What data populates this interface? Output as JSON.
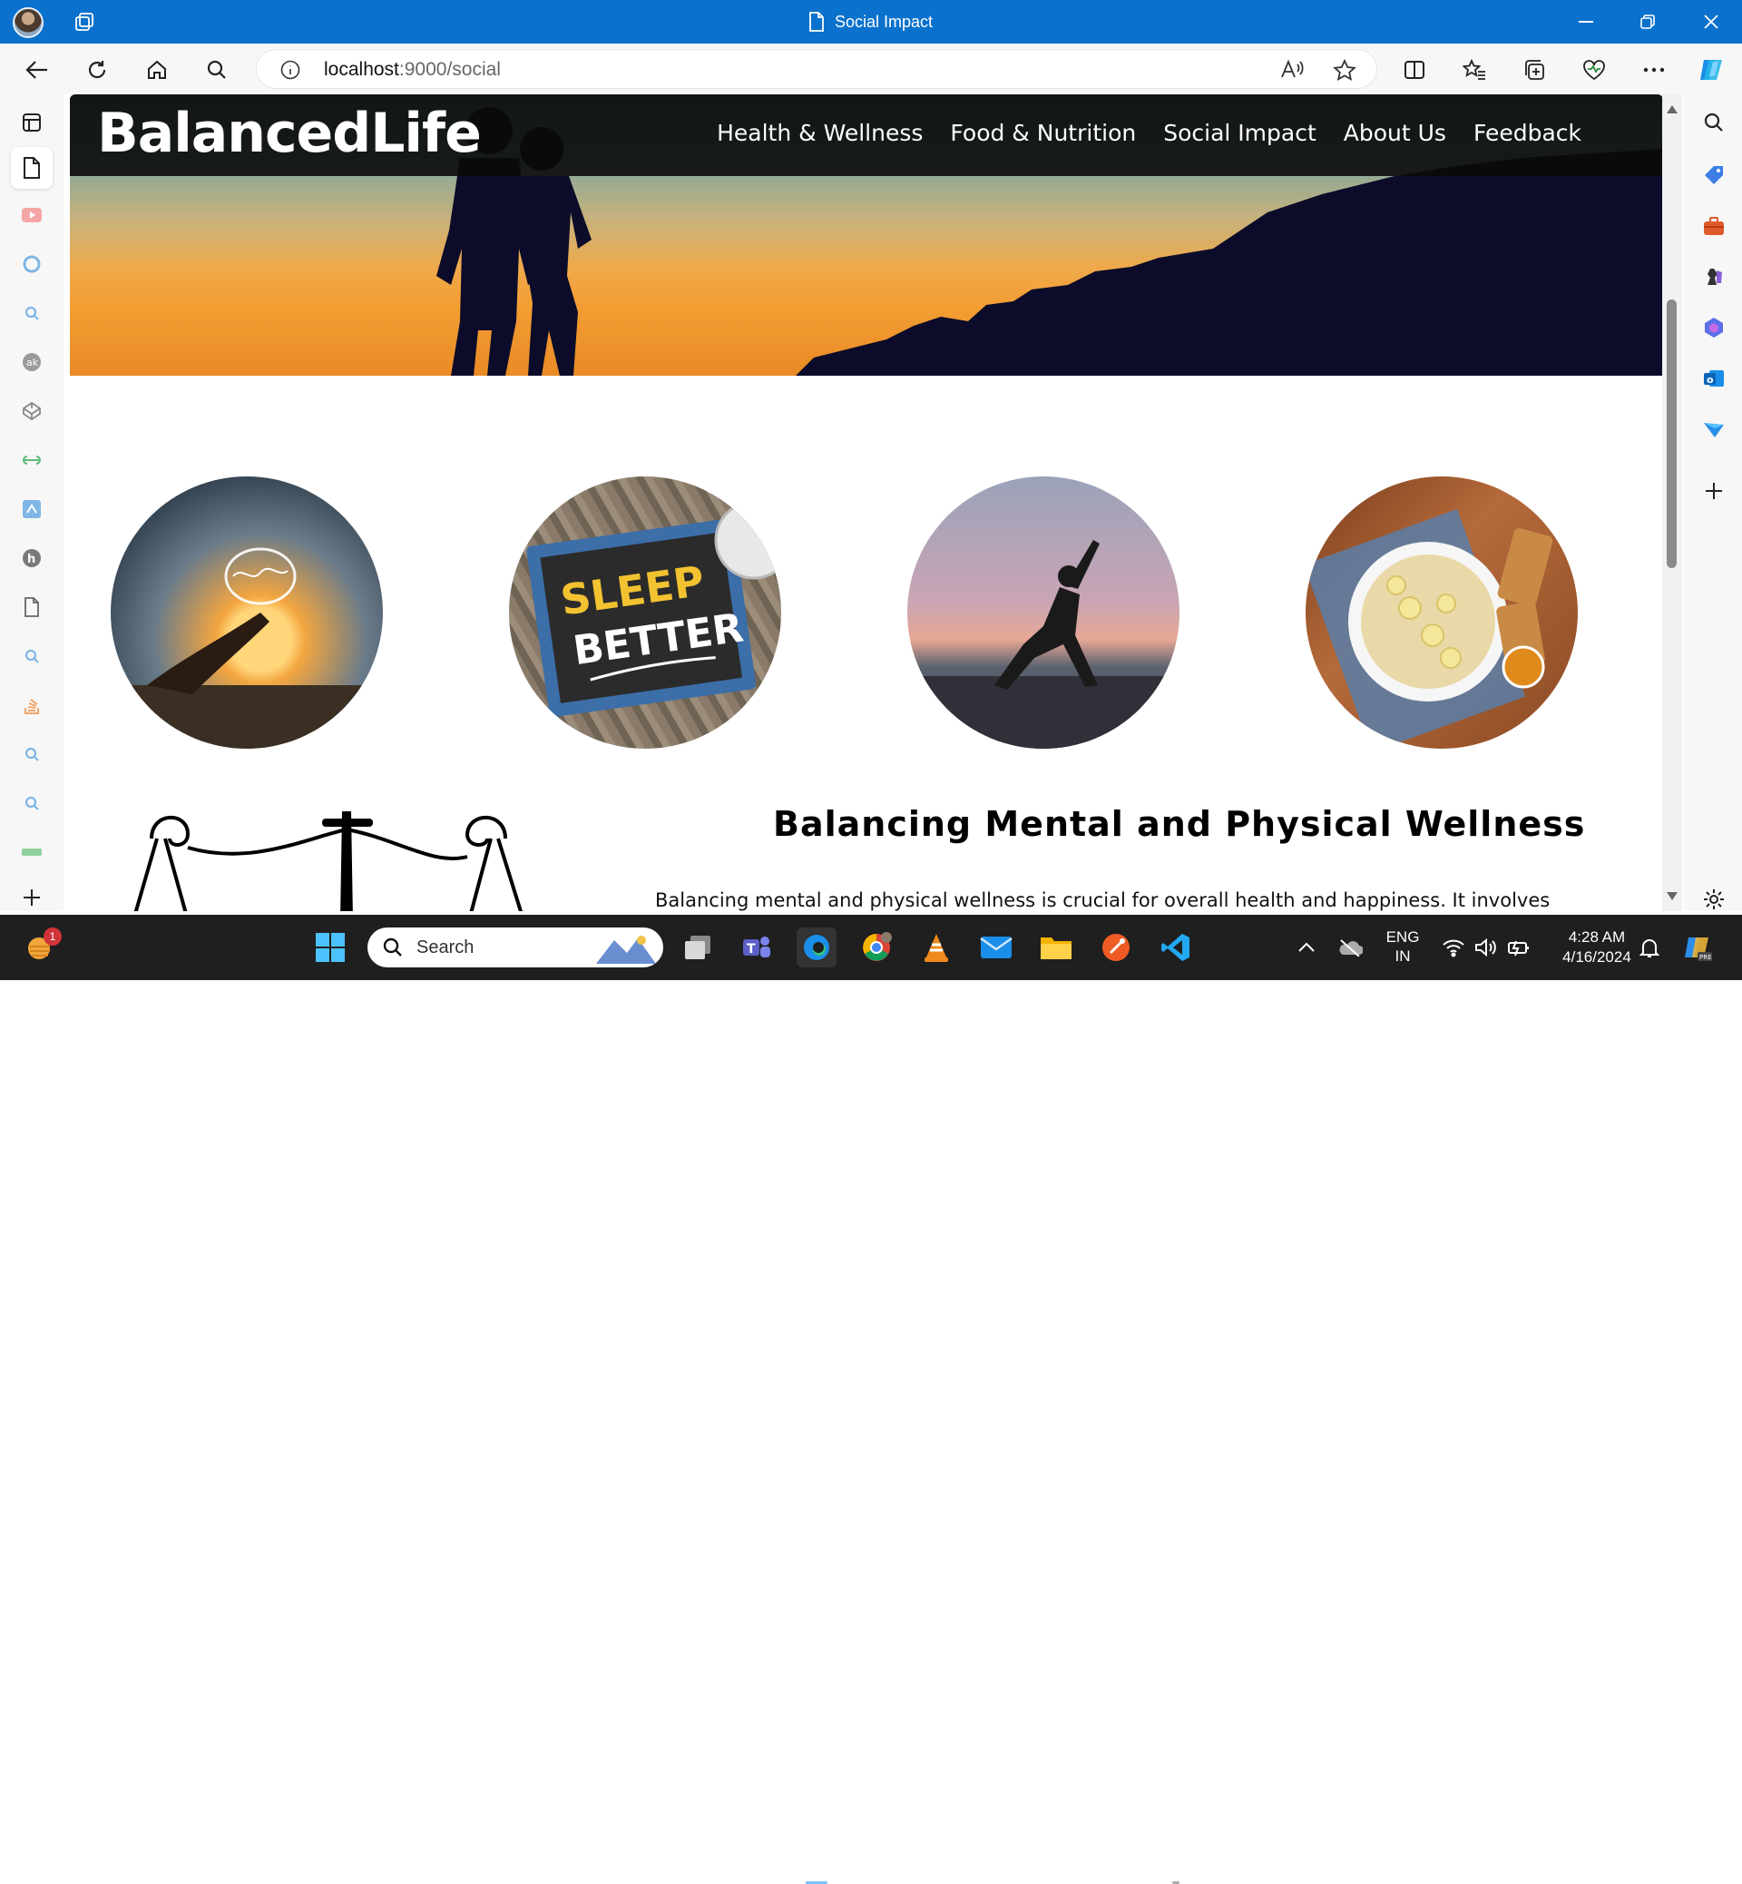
{
  "window": {
    "tab_title": "Social Impact"
  },
  "address_bar": {
    "url_host": "localhost",
    "url_rest": ":9000/social"
  },
  "site": {
    "brand": "BalancedLife",
    "nav": [
      {
        "label": "Health & Wellness"
      },
      {
        "label": "Food & Nutrition"
      },
      {
        "label": "Social Impact"
      },
      {
        "label": "About Us"
      },
      {
        "label": "Feedback"
      }
    ],
    "circle_images": [
      {
        "name": "brain-hand-sunset"
      },
      {
        "name": "sleep-better-chalkboard",
        "text_line1": "SLEEP",
        "text_line2": "BETTER"
      },
      {
        "name": "yoga-sunset"
      },
      {
        "name": "banana-bowl"
      }
    ],
    "section_title": "Balancing Mental and Physical Wellness",
    "section_text": "Balancing mental and physical wellness is crucial for overall health and happiness. It involves"
  },
  "taskbar": {
    "search_label": "Search",
    "notification_count": "1",
    "language_line1": "ENG",
    "language_line2": "IN",
    "time": "4:28 AM",
    "date": "4/16/2024"
  },
  "colors": {
    "titlebar": "#0a72cc",
    "site_nav": "#0a0a0a",
    "taskbar": "#1f1f1f"
  }
}
